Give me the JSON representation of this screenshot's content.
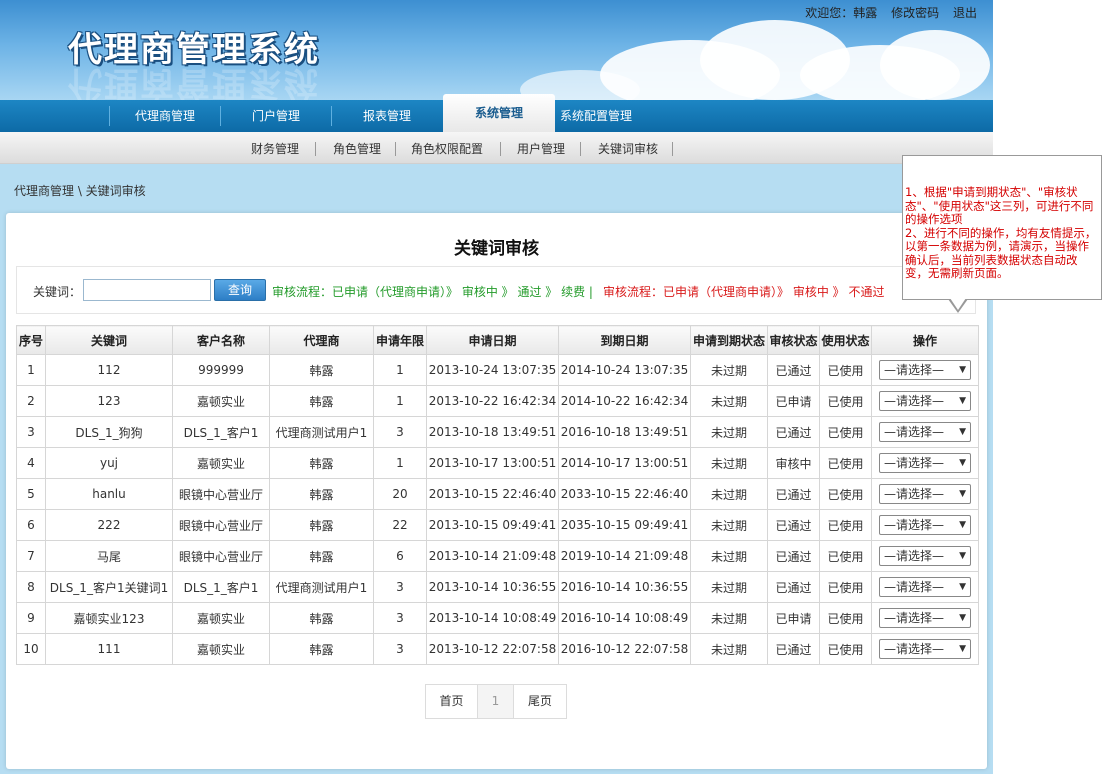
{
  "header": {
    "logo_text": "代理商管理系统",
    "welcome": "欢迎您：韩露",
    "change_password": "修改密码",
    "logout": "退出"
  },
  "main_nav": {
    "items": [
      "代理商管理",
      "门户管理",
      "报表管理",
      "系统管理",
      "系统配置管理"
    ],
    "active": "系统管理"
  },
  "sub_nav": {
    "items": [
      "财务管理",
      "角色管理",
      "角色权限配置",
      "用户管理",
      "关键词审核"
    ]
  },
  "breadcrumb": "代理商管理 \\ 关键词审核",
  "page_title": "关键词审核",
  "search": {
    "label": "关键词：",
    "value": "",
    "button": "查询",
    "flow_green": "审核流程：已申请（代理商申请）》 审核中 》 通过 》 续费 |",
    "flow_red": "审核流程：已申请（代理商申请）》 审核中 》 不通过"
  },
  "table": {
    "headers": [
      "序号",
      "关键词",
      "客户名称",
      "代理商",
      "申请年限",
      "申请日期",
      "到期日期",
      "申请到期状态",
      "审核状态",
      "使用状态",
      "操作"
    ],
    "rows": [
      [
        "1",
        "112",
        "999999",
        "韩露",
        "1",
        "2013-10-24 13:07:35",
        "2014-10-24 13:07:35",
        "未过期",
        "已通过",
        "已使用",
        "—请选择—"
      ],
      [
        "2",
        "123",
        "嘉顿实业",
        "韩露",
        "1",
        "2013-10-22 16:42:34",
        "2014-10-22 16:42:34",
        "未过期",
        "已申请",
        "已使用",
        "—请选择—"
      ],
      [
        "3",
        "DLS_1_狗狗",
        "DLS_1_客户1",
        "代理商测试用户1",
        "3",
        "2013-10-18 13:49:51",
        "2016-10-18 13:49:51",
        "未过期",
        "已通过",
        "已使用",
        "—请选择—"
      ],
      [
        "4",
        "yuj",
        "嘉顿实业",
        "韩露",
        "1",
        "2013-10-17 13:00:51",
        "2014-10-17 13:00:51",
        "未过期",
        "审核中",
        "已使用",
        "—请选择—"
      ],
      [
        "5",
        "hanlu",
        "眼镜中心营业厅",
        "韩露",
        "20",
        "2013-10-15 22:46:40",
        "2033-10-15 22:46:40",
        "未过期",
        "已通过",
        "已使用",
        "—请选择—"
      ],
      [
        "6",
        "222",
        "眼镜中心营业厅",
        "韩露",
        "22",
        "2013-10-15 09:49:41",
        "2035-10-15 09:49:41",
        "未过期",
        "已通过",
        "已使用",
        "—请选择—"
      ],
      [
        "7",
        "马尾",
        "眼镜中心营业厅",
        "韩露",
        "6",
        "2013-10-14 21:09:48",
        "2019-10-14 21:09:48",
        "未过期",
        "已通过",
        "已使用",
        "—请选择—"
      ],
      [
        "8",
        "DLS_1_客户1关键词1",
        "DLS_1_客户1",
        "代理商测试用户1",
        "3",
        "2013-10-14 10:36:55",
        "2016-10-14 10:36:55",
        "未过期",
        "已通过",
        "已使用",
        "—请选择—"
      ],
      [
        "9",
        "嘉顿实业123",
        "嘉顿实业",
        "韩露",
        "3",
        "2013-10-14 10:08:49",
        "2016-10-14 10:08:49",
        "未过期",
        "已申请",
        "已使用",
        "—请选择—"
      ],
      [
        "10",
        "111",
        "嘉顿实业",
        "韩露",
        "3",
        "2013-10-12 22:07:58",
        "2016-10-12 22:07:58",
        "未过期",
        "已通过",
        "已使用",
        "—请选择—"
      ]
    ]
  },
  "pager": {
    "first": "首页",
    "current": "1",
    "last": "尾页"
  },
  "tooltip": {
    "line1": "1、根据\"申请到期状态\"、\"审核状态\"、\"使用状态\"这三列，可进行不同的操作选项",
    "line2": "2、进行不同的操作，均有友情提示，以第一条数据为例，请演示，当操作确认后，当前列表数据状态自动改变，无需刷新页面。"
  },
  "colors": {
    "nav_blue": "#0d6aa6",
    "status_green": "#239b2a",
    "tip_red": "#d40000",
    "body_bg": "#b6ddf2"
  }
}
